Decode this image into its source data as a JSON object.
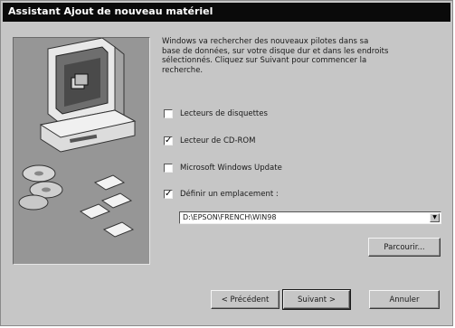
{
  "window": {
    "title": "Assistant Ajout de nouveau matériel"
  },
  "description": "Windows va rechercher des nouveaux pilotes dans sa\nbase de données, sur votre disque dur et dans les endroits\nsélectionnés. Cliquez sur Suivant pour commencer la\nrecherche.",
  "options": [
    {
      "label": "Lecteurs de disquettes",
      "checked": false
    },
    {
      "label": "Lecteur de CD-ROM",
      "checked": true
    },
    {
      "label": "Microsoft Windows Update",
      "checked": false
    },
    {
      "label": "Définir un emplacement :",
      "checked": true
    }
  ],
  "location": {
    "value": "D:\\EPSON\\FRENCH\\WIN98"
  },
  "buttons": {
    "browse": "Parcourir...",
    "back": "< Précédent",
    "next": "Suivant >",
    "cancel": "Annuler"
  },
  "icons": {
    "illustration": "computer-with-disks-illustration",
    "dropdown": "chevron-down-icon"
  }
}
